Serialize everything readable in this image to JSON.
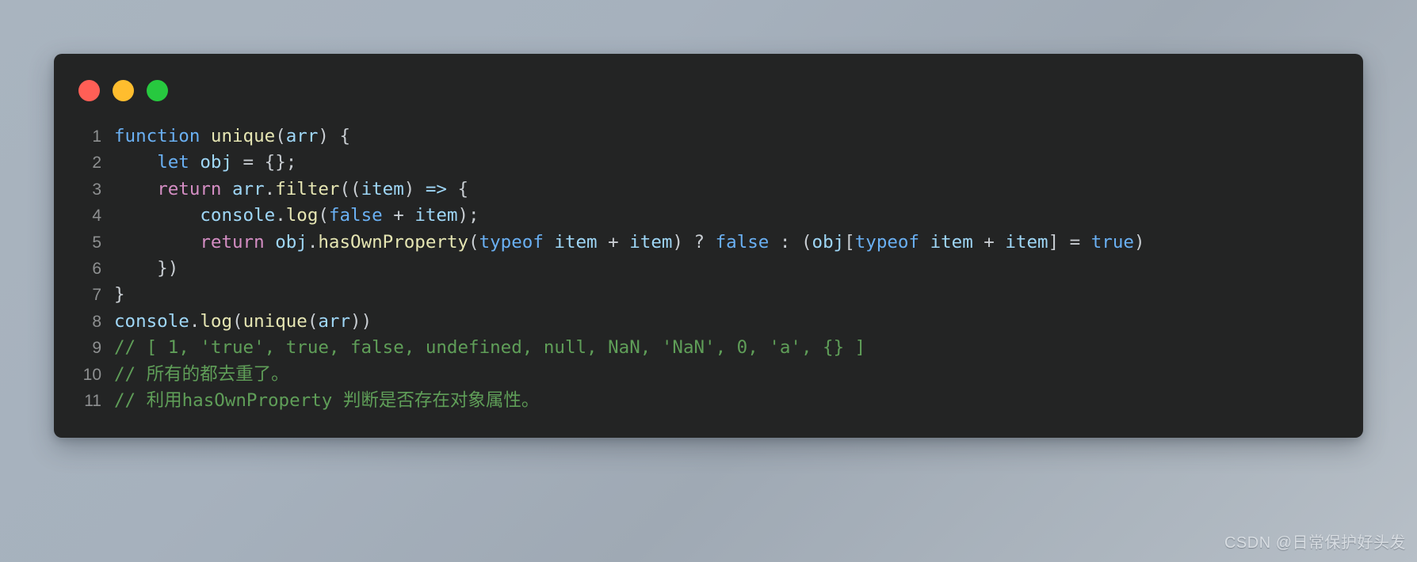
{
  "window": {
    "controls": [
      {
        "name": "close",
        "color": "#ff5f56"
      },
      {
        "name": "minimize",
        "color": "#ffbd2e"
      },
      {
        "name": "maximize",
        "color": "#27c93f"
      }
    ],
    "background_color": "#232424",
    "page_background_color": "#a9b4bf"
  },
  "editor": {
    "language": "javascript",
    "theme_colors": {
      "keyword": "#6ab0f3",
      "control": "#d58ec4",
      "function": "#e6e6b3",
      "variable": "#9fd7f7",
      "punctuation": "#c8cdd2",
      "comment": "#5f9e58",
      "line_number": "#8e9091"
    },
    "line_numbers": [
      "1",
      "2",
      "3",
      "4",
      "5",
      "6",
      "7",
      "8",
      "9",
      "10",
      "11"
    ],
    "lines": [
      {
        "number": "1",
        "text": "function unique(arr) {"
      },
      {
        "number": "2",
        "text": "    let obj = {};"
      },
      {
        "number": "3",
        "text": "    return arr.filter((item) => {"
      },
      {
        "number": "4",
        "text": "        console.log(false + item);"
      },
      {
        "number": "5",
        "text": "        return obj.hasOwnProperty(typeof item + item) ? false : (obj[typeof item + item] = true)"
      },
      {
        "number": "6",
        "text": "    })"
      },
      {
        "number": "7",
        "text": "}"
      },
      {
        "number": "8",
        "text": "console.log(unique(arr))"
      },
      {
        "number": "9",
        "text": "// [ 1, 'true', true, false, undefined, null, NaN, 'NaN', 0, 'a', {} ]"
      },
      {
        "number": "10",
        "text": "// 所有的都去重了。"
      },
      {
        "number": "11",
        "text": "// 利用hasOwnProperty 判断是否存在对象属性。"
      }
    ],
    "tokens": {
      "l1": [
        {
          "t": "function",
          "c": "t-kw"
        },
        {
          "t": " ",
          "c": "t-punct"
        },
        {
          "t": "unique",
          "c": "t-fn"
        },
        {
          "t": "(",
          "c": "t-punct"
        },
        {
          "t": "arr",
          "c": "t-var"
        },
        {
          "t": ") {",
          "c": "t-punct"
        }
      ],
      "l2": [
        {
          "t": "    ",
          "c": "t-punct"
        },
        {
          "t": "let",
          "c": "t-kw"
        },
        {
          "t": " ",
          "c": "t-punct"
        },
        {
          "t": "obj",
          "c": "t-var"
        },
        {
          "t": " = {};",
          "c": "t-punct"
        }
      ],
      "l3": [
        {
          "t": "    ",
          "c": "t-punct"
        },
        {
          "t": "return",
          "c": "t-ctl"
        },
        {
          "t": " ",
          "c": "t-punct"
        },
        {
          "t": "arr",
          "c": "t-var"
        },
        {
          "t": ".",
          "c": "t-punct"
        },
        {
          "t": "filter",
          "c": "t-fn"
        },
        {
          "t": "((",
          "c": "t-punct"
        },
        {
          "t": "item",
          "c": "t-var"
        },
        {
          "t": ") ",
          "c": "t-punct"
        },
        {
          "t": "=>",
          "c": "t-var"
        },
        {
          "t": " {",
          "c": "t-punct"
        }
      ],
      "l4": [
        {
          "t": "        ",
          "c": "t-punct"
        },
        {
          "t": "console",
          "c": "t-var"
        },
        {
          "t": ".",
          "c": "t-punct"
        },
        {
          "t": "log",
          "c": "t-fn"
        },
        {
          "t": "(",
          "c": "t-punct"
        },
        {
          "t": "false",
          "c": "t-kw"
        },
        {
          "t": " + ",
          "c": "t-punct"
        },
        {
          "t": "item",
          "c": "t-var"
        },
        {
          "t": ");",
          "c": "t-punct"
        }
      ],
      "l5": [
        {
          "t": "        ",
          "c": "t-punct"
        },
        {
          "t": "return",
          "c": "t-ctl"
        },
        {
          "t": " ",
          "c": "t-punct"
        },
        {
          "t": "obj",
          "c": "t-var"
        },
        {
          "t": ".",
          "c": "t-punct"
        },
        {
          "t": "hasOwnProperty",
          "c": "t-fn"
        },
        {
          "t": "(",
          "c": "t-punct"
        },
        {
          "t": "typeof",
          "c": "t-kw"
        },
        {
          "t": " ",
          "c": "t-punct"
        },
        {
          "t": "item",
          "c": "t-var"
        },
        {
          "t": " + ",
          "c": "t-punct"
        },
        {
          "t": "item",
          "c": "t-var"
        },
        {
          "t": ") ? ",
          "c": "t-punct"
        },
        {
          "t": "false",
          "c": "t-kw"
        },
        {
          "t": " : (",
          "c": "t-punct"
        },
        {
          "t": "obj",
          "c": "t-var"
        },
        {
          "t": "[",
          "c": "t-punct"
        },
        {
          "t": "typeof",
          "c": "t-kw"
        },
        {
          "t": " ",
          "c": "t-punct"
        },
        {
          "t": "item",
          "c": "t-var"
        },
        {
          "t": " + ",
          "c": "t-punct"
        },
        {
          "t": "item",
          "c": "t-var"
        },
        {
          "t": "] = ",
          "c": "t-punct"
        },
        {
          "t": "true",
          "c": "t-kw"
        },
        {
          "t": ")",
          "c": "t-punct"
        }
      ],
      "l6": [
        {
          "t": "    })",
          "c": "t-punct"
        }
      ],
      "l7": [
        {
          "t": "}",
          "c": "t-punct"
        }
      ],
      "l8": [
        {
          "t": "console",
          "c": "t-var"
        },
        {
          "t": ".",
          "c": "t-punct"
        },
        {
          "t": "log",
          "c": "t-fn"
        },
        {
          "t": "(",
          "c": "t-punct"
        },
        {
          "t": "unique",
          "c": "t-fn"
        },
        {
          "t": "(",
          "c": "t-punct"
        },
        {
          "t": "arr",
          "c": "t-var"
        },
        {
          "t": "))",
          "c": "t-punct"
        }
      ],
      "l9": [
        {
          "t": "// [ 1, 'true', true, false, undefined, null, NaN, 'NaN', 0, 'a', {} ]",
          "c": "t-comment"
        }
      ],
      "l10": [
        {
          "t": "// 所有的都去重了。",
          "c": "t-comment"
        }
      ],
      "l11": [
        {
          "t": "// 利用hasOwnProperty 判断是否存在对象属性。",
          "c": "t-comment"
        }
      ]
    }
  },
  "watermark": {
    "text": "CSDN @日常保护好头发"
  }
}
